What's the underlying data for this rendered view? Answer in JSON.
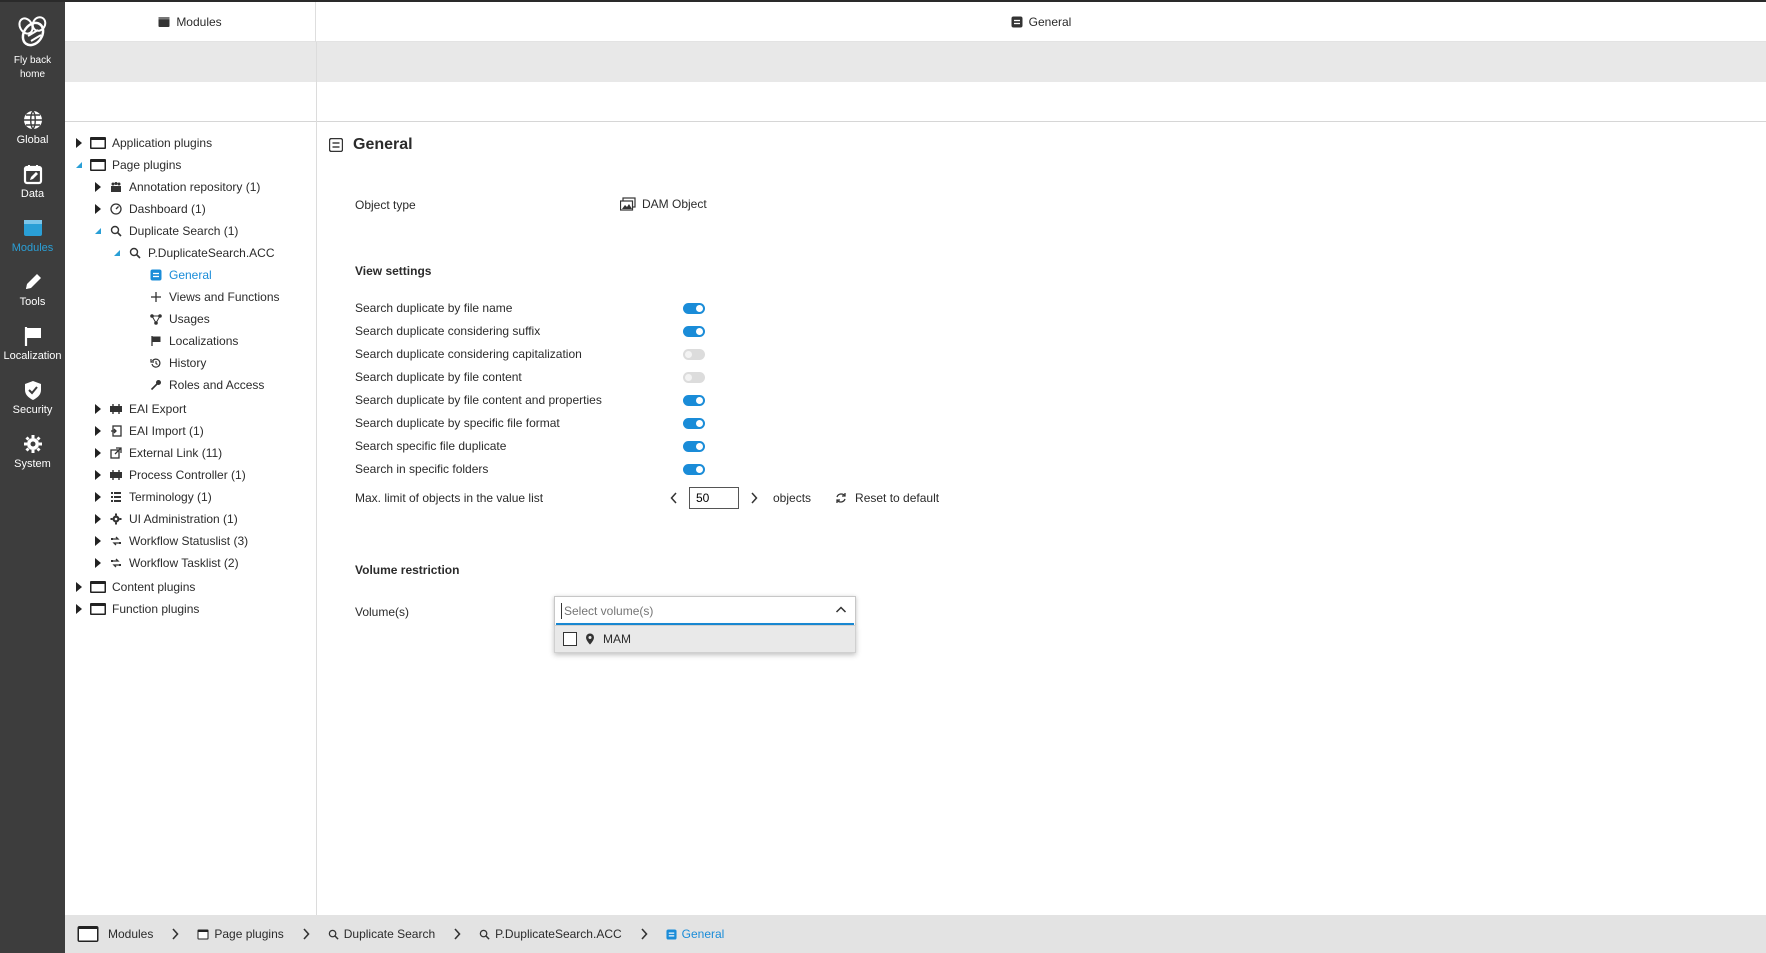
{
  "rail": {
    "home_label": "Fly back home",
    "items": [
      {
        "label": "Global",
        "icon": "globe-icon"
      },
      {
        "label": "Data",
        "icon": "calendar-edit-icon"
      },
      {
        "label": "Modules",
        "icon": "window-icon",
        "active": true
      },
      {
        "label": "Tools",
        "icon": "pencil-icon"
      },
      {
        "label": "Localization",
        "icon": "flag-icon"
      },
      {
        "label": "Security",
        "icon": "shield-check-icon"
      },
      {
        "label": "System",
        "icon": "gear-icon"
      }
    ]
  },
  "topbar": {
    "left_title": "Modules",
    "right_title": "General"
  },
  "tree": {
    "application_plugins": "Application plugins",
    "page_plugins": "Page plugins",
    "annotation_repository": "Annotation repository (1)",
    "dashboard": "Dashboard (1)",
    "duplicate_search": "Duplicate Search (1)",
    "p_duplicatesearch": "P.DuplicateSearch.ACC",
    "general": "General",
    "views_functions": "Views and Functions",
    "usages": "Usages",
    "localizations": "Localizations",
    "history": "History",
    "roles_access": "Roles and Access",
    "eai_export": "EAI Export",
    "eai_import": "EAI Import (1)",
    "external_link": "External Link (11)",
    "process_controller": "Process Controller (1)",
    "terminology": "Terminology (1)",
    "ui_administration": "UI Administration (1)",
    "workflow_statuslist": "Workflow Statuslist (3)",
    "workflow_tasklist": "Workflow Tasklist (2)",
    "content_plugins": "Content plugins",
    "function_plugins": "Function plugins"
  },
  "main": {
    "title": "General",
    "object_type_label": "Object type",
    "object_type_value": "DAM Object",
    "view_settings_title": "View settings",
    "settings": [
      {
        "label": "Search duplicate by file name",
        "on": true
      },
      {
        "label": "Search duplicate considering suffix",
        "on": true
      },
      {
        "label": "Search duplicate considering capitalization",
        "on": false
      },
      {
        "label": "Search duplicate by file content",
        "on": false
      },
      {
        "label": "Search duplicate by file content and properties",
        "on": true
      },
      {
        "label": "Search duplicate by specific file format",
        "on": true
      },
      {
        "label": "Search specific file duplicate",
        "on": true
      },
      {
        "label": "Search in specific folders",
        "on": true
      }
    ],
    "max_limit_label": "Max. limit of objects in the value list",
    "max_limit_value": "50",
    "max_limit_unit": "objects",
    "reset_label": "Reset to default",
    "volume_restriction_title": "Volume restriction",
    "volumes_label": "Volume(s)",
    "volumes_placeholder": "Select volume(s)",
    "volume_options": [
      "MAM"
    ]
  },
  "breadcrumb": [
    "Modules",
    "Page plugins",
    "Duplicate Search",
    "P.DuplicateSearch.ACC",
    "General"
  ],
  "colors": {
    "accent": "#1a8cd8",
    "rail_bg": "#3d3d3d"
  }
}
